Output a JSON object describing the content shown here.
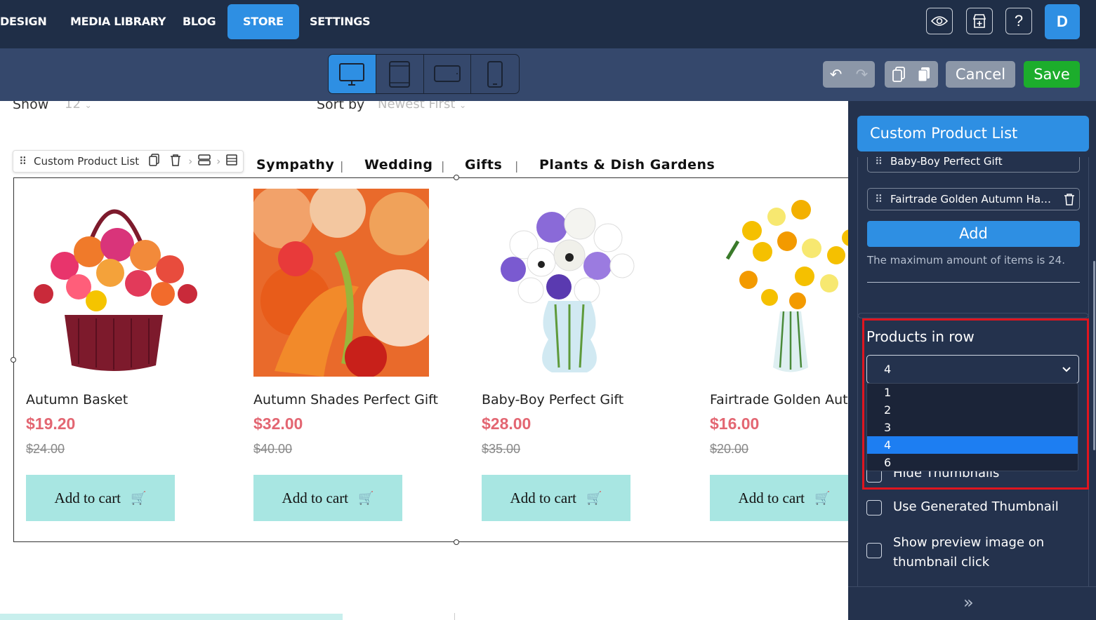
{
  "topnav": {
    "items": [
      {
        "label": "DESIGN",
        "active": false
      },
      {
        "label": "MEDIA LIBRARY",
        "active": false
      },
      {
        "label": "BLOG",
        "active": false
      },
      {
        "label": "STORE",
        "active": true
      },
      {
        "label": "SETTINGS",
        "active": false
      }
    ],
    "icons": [
      "eye-icon",
      "store-add-icon",
      "help-icon"
    ],
    "avatar_letter": "D"
  },
  "toolbar": {
    "devices": [
      "desktop-icon",
      "tablet-portrait-icon",
      "tablet-landscape-icon",
      "mobile-icon"
    ],
    "active_device": "desktop",
    "cancel_label": "Cancel",
    "save_label": "Save"
  },
  "canvas": {
    "show_label": "Show",
    "show_value": "12",
    "sort_label": "Sort by",
    "sort_value": "Newest First",
    "categories": [
      "Sympathy",
      "Wedding",
      "Gifts",
      "Plants & Dish Gardens"
    ],
    "block_toolbar_label": "Custom Product List",
    "products": [
      {
        "name": "Autumn Basket",
        "price": "$19.20",
        "old_price": "$24.00",
        "cart_label": "Add to cart"
      },
      {
        "name": "Autumn Shades Perfect Gift",
        "price": "$32.00",
        "old_price": "$40.00",
        "cart_label": "Add to cart"
      },
      {
        "name": "Baby-Boy Perfect Gift",
        "price": "$28.00",
        "old_price": "$35.00",
        "cart_label": "Add to cart"
      },
      {
        "name": "Fairtrade Golden Autur",
        "price": "$16.00",
        "old_price": "$20.00",
        "cart_label": "Add to cart"
      }
    ]
  },
  "panel": {
    "title": "Custom Product List",
    "items": [
      "Baby-Boy Perfect Gift",
      "Fairtrade Golden Autumn Ha…"
    ],
    "add_label": "Add",
    "max_note": "The maximum amount of items is 24.",
    "products_in_row_label": "Products in row",
    "products_in_row_value": "4",
    "products_in_row_options": [
      "1",
      "2",
      "3",
      "4",
      "6"
    ],
    "hide_thumbnails_label": "Hide Thumbnails",
    "use_generated_thumbnail_label": "Use Generated Thumbnail",
    "show_preview_label_line1": "Show preview image on",
    "show_preview_label_line2": "thumbnail click",
    "highlight_color": "#e0151f"
  }
}
